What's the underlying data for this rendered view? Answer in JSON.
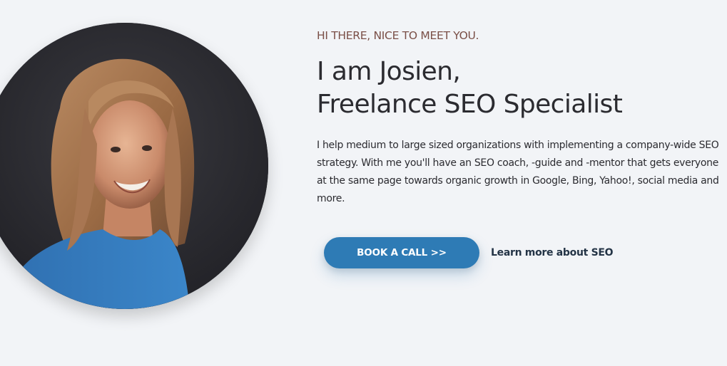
{
  "hero": {
    "greeting": "HI THERE,  NICE TO  MEET YOU.",
    "headline_line1": "I am Josien,",
    "headline_line2": "Freelance SEO Specialist",
    "description": "I help medium to large sized organizations with implementing a company-wide SEO strategy. With me you'll have an SEO coach, -guide and -mentor that gets everyone at the same page towards organic growth in Google, Bing, Yahoo!, social media and more.",
    "primary_cta": "BOOK A CALL >>",
    "secondary_link": "Learn more about SEO"
  },
  "portrait": {
    "icon": "portrait-photo"
  },
  "colors": {
    "background": "#f2f4f7",
    "accent": "#2e7bb5",
    "greeting": "#7a4f47",
    "text": "#2b2b30",
    "link": "#243446"
  }
}
